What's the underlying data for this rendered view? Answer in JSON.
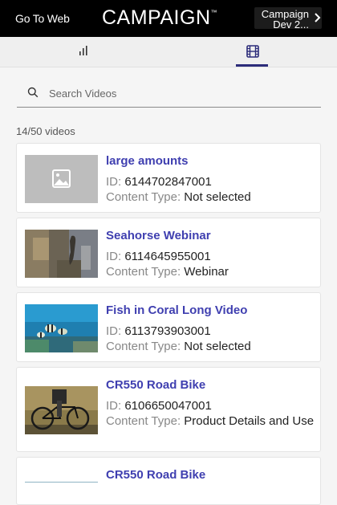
{
  "header": {
    "go_to_web": "Go To Web",
    "brand": "CAMPAIGN",
    "brand_tm": "™",
    "account_line1": "Campaign",
    "account_line2": "Dev 2..."
  },
  "tabs": [
    {
      "name": "analytics",
      "icon": "bar-chart-icon",
      "active": false
    },
    {
      "name": "videos",
      "icon": "film-icon",
      "active": true
    }
  ],
  "search": {
    "placeholder": "Search Videos",
    "value": ""
  },
  "results": {
    "count_text": "14/50 videos"
  },
  "labels": {
    "id": "ID:",
    "content_type": "Content Type:"
  },
  "videos": [
    {
      "title": "large amounts",
      "id": "6144702847001",
      "content_type": "Not selected",
      "thumbnail": "placeholder-image-icon"
    },
    {
      "title": "Seahorse Webinar",
      "id": "6114645955001",
      "content_type": "Webinar",
      "thumbnail": "seahorse"
    },
    {
      "title": "Fish in Coral Long Video",
      "id": "6113793903001",
      "content_type": "Not selected",
      "thumbnail": "coral-fish"
    },
    {
      "title": "CR550 Road Bike",
      "id": "6106650047001",
      "content_type": "Product Details and Use",
      "thumbnail": "cyclist"
    },
    {
      "title": "CR550 Road Bike",
      "id": "",
      "content_type": "",
      "thumbnail": "road"
    }
  ],
  "colors": {
    "header_bg": "#000000",
    "title": "#3f3fb0",
    "active_tab": "#2c2c7a"
  }
}
